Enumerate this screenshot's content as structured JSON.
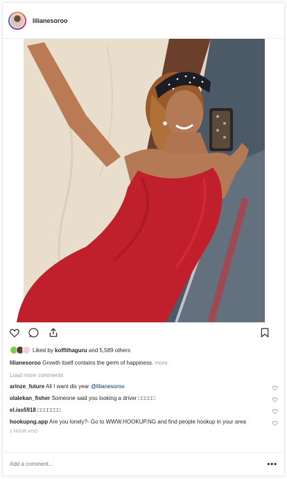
{
  "post": {
    "username": "lilianesoroo",
    "photo_alt": "woman in red dress taking mirror selfie"
  },
  "likes": {
    "prefix": "Liked by ",
    "user": "koffithaguru",
    "suffix": " and 5,589 others"
  },
  "caption": {
    "user": "lilianesoroo",
    "text": " Growth itself contains the germ of happiness.",
    "more": " more"
  },
  "load_more": "Load more comments",
  "comments": [
    {
      "user": "arinze_future",
      "text": " All I want dis year ",
      "mention": "@lilianesoroo"
    },
    {
      "user": "olalekan_fisher",
      "text": " Someone said you looking a driver □□□□□",
      "mention": ""
    },
    {
      "user": "el.ias5918",
      "text": " □□□□□□□",
      "mention": ""
    },
    {
      "user": "hookupng.app",
      "text": " Are you lonely?- Go to WWW.HOOKUP.NG and find people hookup in your area",
      "mention": ""
    }
  ],
  "timestamp": "1 HOUR AGO",
  "add_comment": {
    "placeholder": "Add a comment..."
  },
  "more_options": "•••",
  "colors": {
    "dress": "#c0202c",
    "wall": "#e3d6c3",
    "link": "#003569",
    "muted": "#999999"
  },
  "icons": {
    "like": "heart-icon",
    "comment": "comment-icon",
    "share": "share-icon",
    "save": "bookmark-icon"
  }
}
